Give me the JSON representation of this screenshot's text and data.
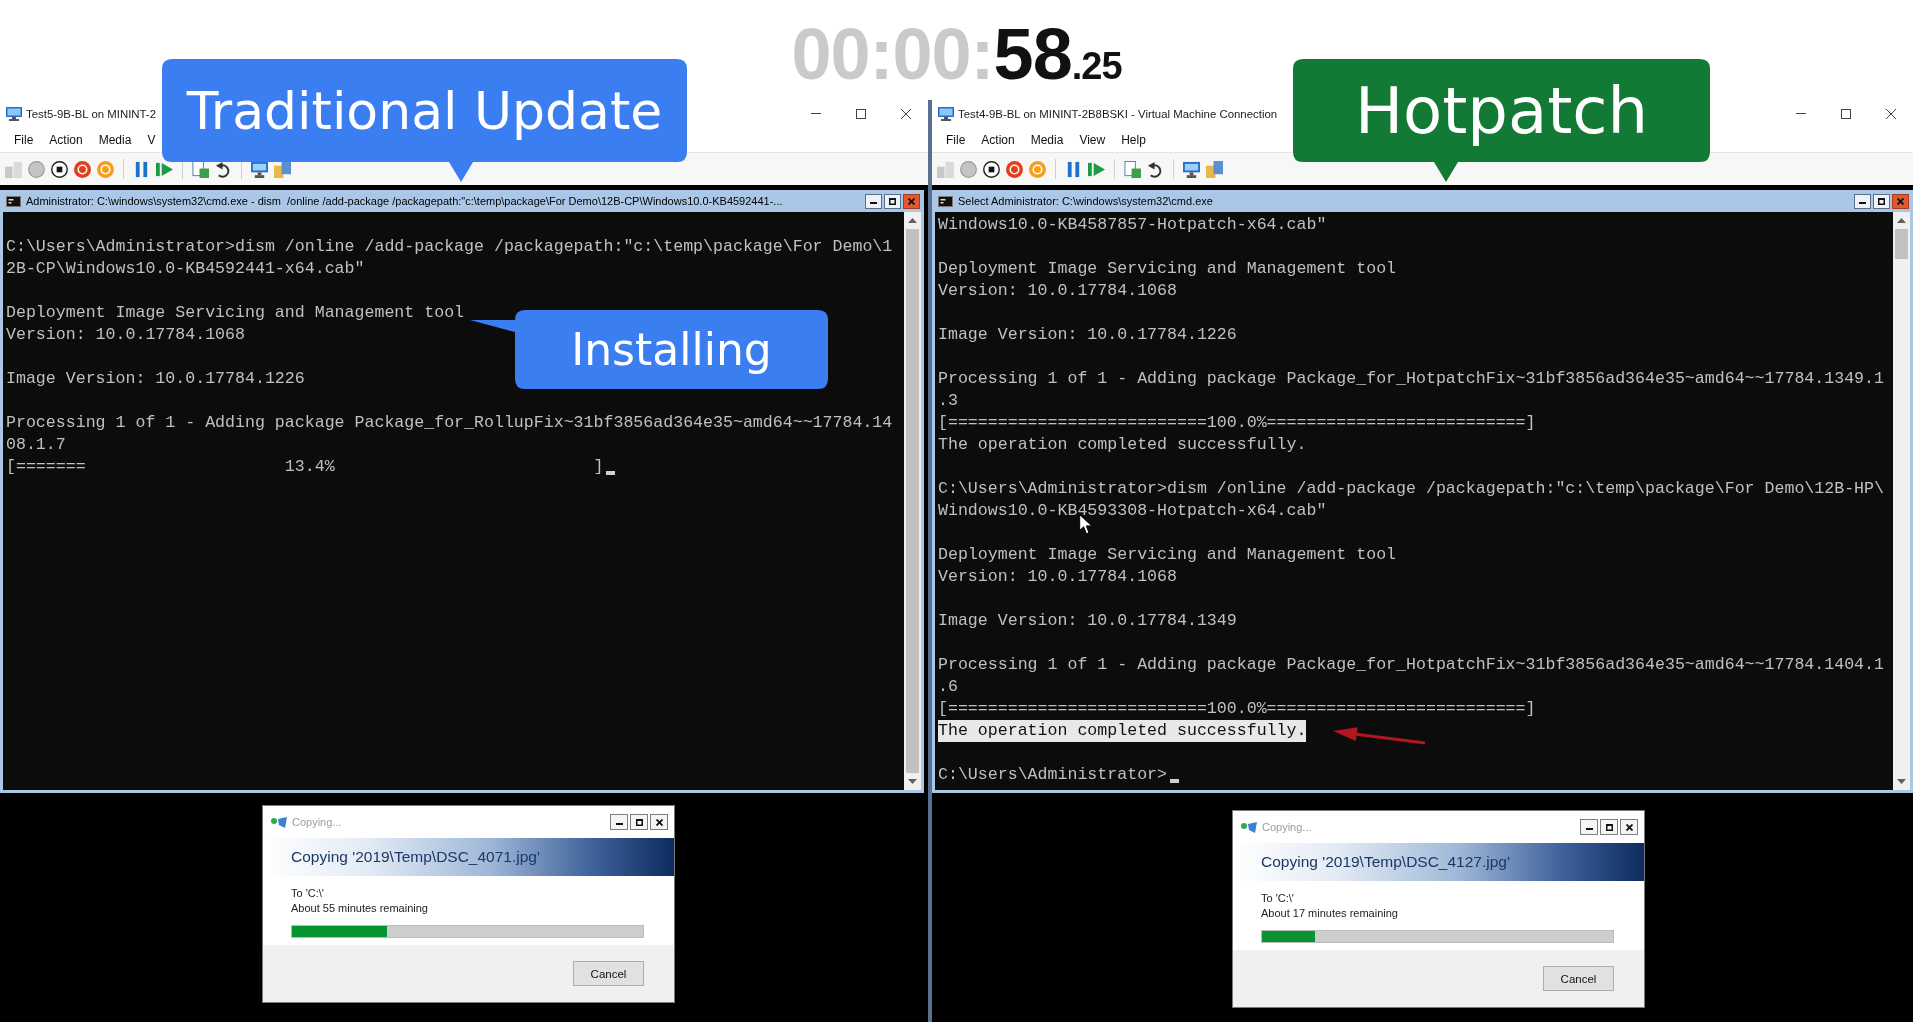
{
  "timer": {
    "dimmed": "00:00:",
    "seconds": "58",
    "fraction": ".25"
  },
  "callouts": [
    {
      "text": "Traditional Update",
      "color": "#3a7ef2",
      "kind": "tail-down"
    },
    {
      "text": "Hotpatch",
      "color": "#127a35",
      "kind": "tail-down"
    },
    {
      "text": "Installing",
      "color": "#3a7ef2",
      "kind": "tail-left"
    }
  ],
  "panes": [
    {
      "window_title": "Test5-9B-BL on MININT-2",
      "menu": [
        "File",
        "Action",
        "Media",
        "V"
      ],
      "console": {
        "title": "Administrator: C:\\windows\\system32\\cmd.exe - dism  /online /add-package /packagepath:\"c:\\temp\\package\\For Demo\\12B-CP\\Windows10.0-KB4592441-...",
        "cursor": true,
        "blocks": [
          [
            {
              "text": "C:\\Users\\Administrator>dism /online /add-package /packagepath:\"c:\\temp\\package\\For Demo\\12B-CP\\Windows10.0-KB4592441-x64.cab\"",
              "selected": false
            }
          ],
          [
            {
              "text": "Deployment Image Servicing and Management tool",
              "selected": false
            },
            {
              "text": "Version: 10.0.17784.1068",
              "selected": false
            }
          ],
          [
            {
              "text": "Image Version: 10.0.17784.1226",
              "selected": false
            }
          ],
          [
            {
              "text": "Processing 1 of 1 - Adding package Package_for_RollupFix~31bf3856ad364e35~amd64~~17784.1408.1.7",
              "selected": false
            },
            {
              "text": "[=======                    13.4%                          ]",
              "selected": false
            }
          ]
        ]
      },
      "copy_dialog": {
        "title": "Copying...",
        "heading": "Copying '2019\\Temp\\DSC_4071.jpg'",
        "destination": "To 'C:\\'",
        "remaining": "About 55 minutes remaining",
        "level": 0.27,
        "button": "Cancel"
      }
    },
    {
      "window_title": "Test4-9B-BL on MININT-2B8BSKI - Virtual Machine Connection",
      "menu": [
        "File",
        "Action",
        "Media",
        "View",
        "Help"
      ],
      "console": {
        "title": "Select Administrator: C:\\windows\\system32\\cmd.exe",
        "cursor": true,
        "blocks": [
          [
            {
              "text": "Windows10.0-KB4587857-Hotpatch-x64.cab\"",
              "selected": false
            }
          ],
          [
            {
              "text": "Deployment Image Servicing and Management tool",
              "selected": false
            },
            {
              "text": "Version: 10.0.17784.1068",
              "selected": false
            }
          ],
          [
            {
              "text": "Image Version: 10.0.17784.1226",
              "selected": false
            }
          ],
          [
            {
              "text": "Processing 1 of 1 - Adding package Package_for_HotpatchFix~31bf3856ad364e35~amd64~~17784.1349.1.3",
              "selected": false
            },
            {
              "text": "[==========================100.0%==========================]",
              "selected": false
            },
            {
              "text": "The operation completed successfully.",
              "selected": false
            }
          ],
          [
            {
              "text": "C:\\Users\\Administrator>dism /online /add-package /packagepath:\"c:\\temp\\package\\For Demo\\12B-HP\\Windows10.0-KB4593308-Hotpatch-x64.cab\"",
              "selected": false
            }
          ],
          [
            {
              "text": "Deployment Image Servicing and Management tool",
              "selected": false
            },
            {
              "text": "Version: 10.0.17784.1068",
              "selected": false
            }
          ],
          [
            {
              "text": "Image Version: 10.0.17784.1349",
              "selected": false
            }
          ],
          [
            {
              "text": "Processing 1 of 1 - Adding package Package_for_HotpatchFix~31bf3856ad364e35~amd64~~17784.1404.1.6",
              "selected": false
            },
            {
              "text": "[==========================100.0%==========================]",
              "selected": false
            },
            {
              "text": "The operation completed successfully.",
              "selected": true
            }
          ],
          [
            {
              "text": "C:\\Users\\Administrator>",
              "selected": false
            }
          ]
        ]
      },
      "copy_dialog": {
        "title": "Copying...",
        "heading": "Copying '2019\\Temp\\DSC_4127.jpg'",
        "destination": "To 'C:\\'",
        "remaining": "About 17 minutes remaining",
        "level": 0.15,
        "button": "Cancel"
      }
    }
  ]
}
